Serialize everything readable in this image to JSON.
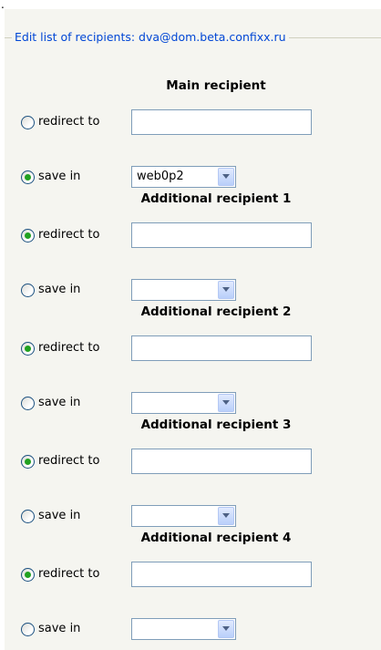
{
  "leading_mark": ".",
  "legend": "Edit list of recipients: dva@dom.beta.confixx.ru",
  "recipients": [
    {
      "heading": "Main recipient",
      "redirect_label": "redirect to",
      "redirect_value": "",
      "save_label": "save in",
      "save_value": "web0p2",
      "selected": "save"
    },
    {
      "heading": "Additional recipient 1",
      "redirect_label": "redirect to",
      "redirect_value": "",
      "save_label": "save in",
      "save_value": "",
      "selected": "redirect"
    },
    {
      "heading": "Additional recipient 2",
      "redirect_label": "redirect to",
      "redirect_value": "",
      "save_label": "save in",
      "save_value": "",
      "selected": "redirect"
    },
    {
      "heading": "Additional recipient 3",
      "redirect_label": "redirect to",
      "redirect_value": "",
      "save_label": "save in",
      "save_value": "",
      "selected": "redirect"
    },
    {
      "heading": "Additional recipient 4",
      "redirect_label": "redirect to",
      "redirect_value": "",
      "save_label": "save in",
      "save_value": "",
      "selected": "redirect"
    }
  ]
}
